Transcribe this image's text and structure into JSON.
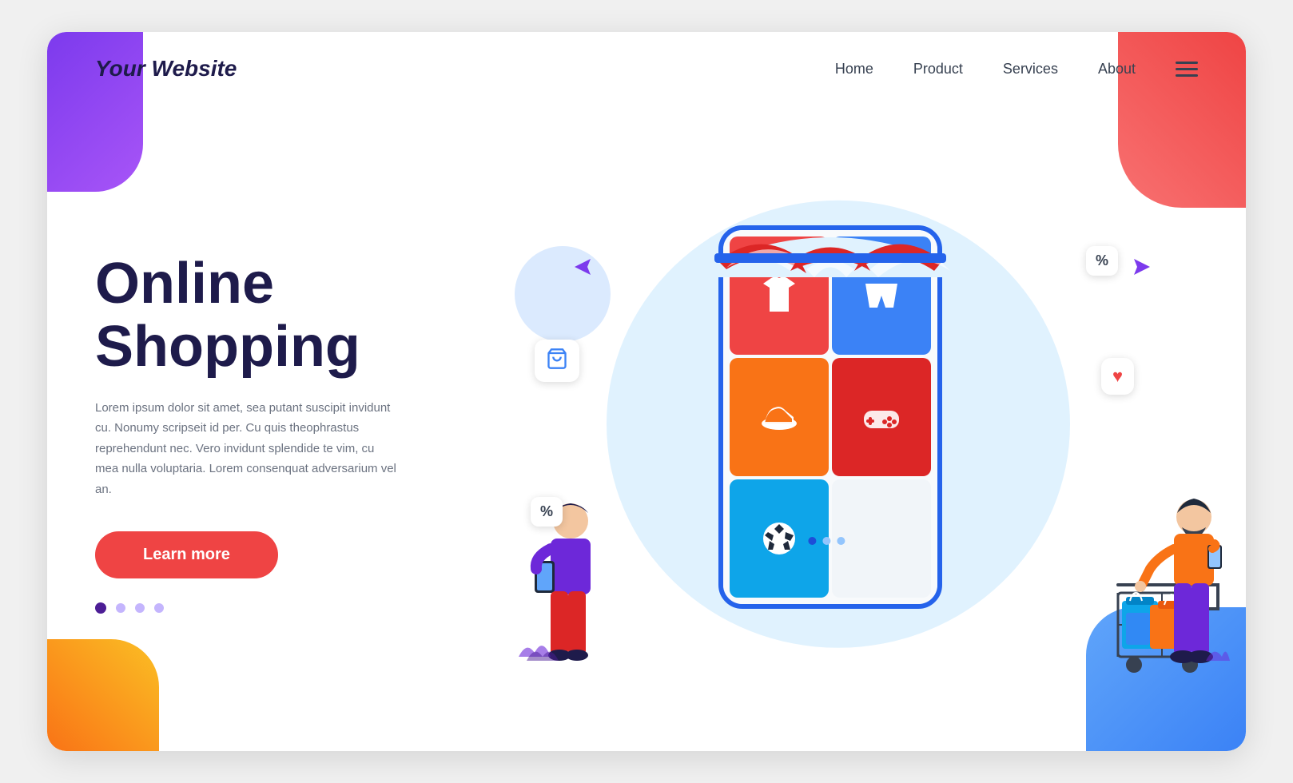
{
  "page": {
    "background": "#f0f0f0",
    "card_bg": "#ffffff"
  },
  "header": {
    "logo": "Your Website",
    "nav": [
      {
        "label": "Home",
        "id": "home"
      },
      {
        "label": "Product",
        "id": "product"
      },
      {
        "label": "Services",
        "id": "services"
      },
      {
        "label": "About",
        "id": "about"
      }
    ],
    "menu_icon": "hamburger-icon"
  },
  "hero": {
    "title_line1": "Online",
    "title_line2": "Shopping",
    "description": "Lorem ipsum dolor sit amet, sea putant suscipit invidunt cu. Nonumy scripseit id per. Cu quis theophrastus reprehendunt nec. Vero invidunt splendide te vim, cu mea nulla voluptaria. Lorem consenquat adversarium vel an.",
    "cta_button": "Learn more"
  },
  "dots": [
    {
      "active": true
    },
    {
      "active": false
    },
    {
      "active": false
    },
    {
      "active": false
    }
  ],
  "illustration": {
    "cart_icon": "🛒",
    "percent_label": "%",
    "heart_icon": "♥",
    "arrow_icon": "➤",
    "phone_dots": [
      {
        "active": true
      },
      {
        "active": false
      },
      {
        "active": false
      }
    ],
    "products": [
      {
        "type": "shirt",
        "color": "red",
        "label": "T-Shirt"
      },
      {
        "type": "shorts",
        "color": "blue",
        "label": "Shorts"
      },
      {
        "type": "shoes",
        "color": "orange",
        "label": "Shoes"
      },
      {
        "type": "gamepad",
        "color": "red2",
        "label": "Gamepad"
      },
      {
        "type": "soccer",
        "color": "cyan",
        "label": "Soccer Ball"
      },
      {
        "type": "empty",
        "color": "white",
        "label": ""
      }
    ]
  }
}
